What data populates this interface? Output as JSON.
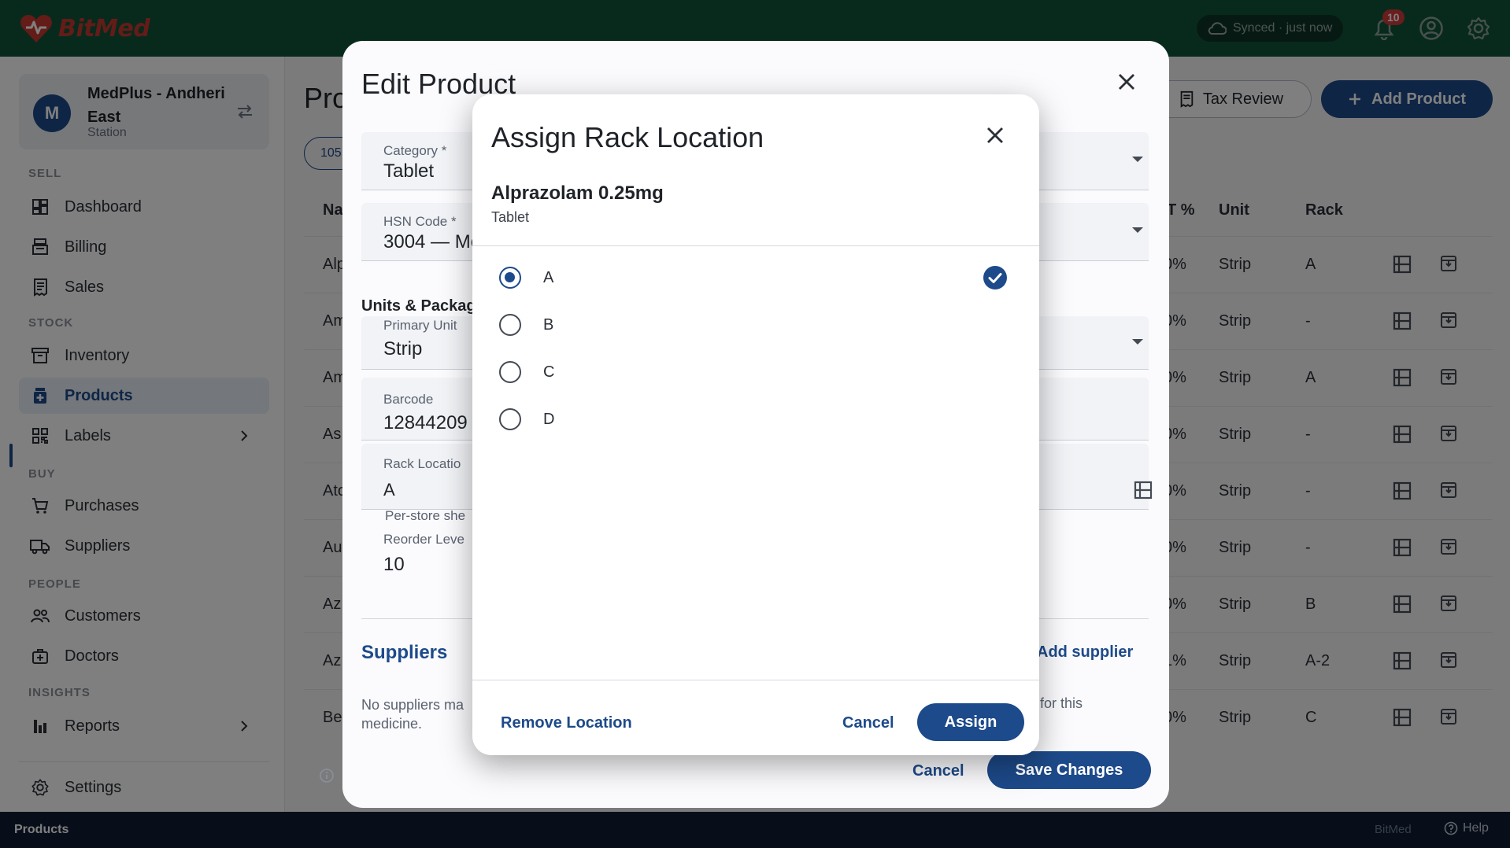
{
  "app": {
    "brand": "BitMed",
    "sync_status": "Synced · just now",
    "notification_count": "10"
  },
  "store": {
    "avatar": "M",
    "name": "MedPlus - Andheri East",
    "role": "Station"
  },
  "sidebar": {
    "sections": {
      "sell": "SELL",
      "stock": "STOCK",
      "buy": "BUY",
      "people": "PEOPLE",
      "insights": "INSIGHTS"
    },
    "items": [
      {
        "label": "Dashboard",
        "icon": "dashboard-icon"
      },
      {
        "label": "Billing",
        "icon": "billing-icon"
      },
      {
        "label": "Sales",
        "icon": "receipt-icon"
      },
      {
        "label": "Inventory",
        "icon": "inventory-icon"
      },
      {
        "label": "Products",
        "icon": "medicine-icon",
        "active": true
      },
      {
        "label": "Labels",
        "icon": "qr-code-icon"
      },
      {
        "label": "Purchases",
        "icon": "cart-icon"
      },
      {
        "label": "Suppliers",
        "icon": "truck-icon"
      },
      {
        "label": "Customers",
        "icon": "people-icon"
      },
      {
        "label": "Doctors",
        "icon": "medical-bag-icon"
      },
      {
        "label": "Reports",
        "icon": "bar-chart-icon"
      },
      {
        "label": "Settings",
        "icon": "gear-icon"
      }
    ]
  },
  "background_page": {
    "title": "Pro",
    "tax_review_label": "Tax Review",
    "add_product_label": "Add Product",
    "chip_label": "105",
    "columns": {
      "name": "Na",
      "gst": "T %",
      "unit": "Unit",
      "rack": "Rack"
    },
    "rows": [
      {
        "name": "Alp",
        "gst": "0%",
        "unit": "Strip",
        "rack": "A"
      },
      {
        "name": "Am",
        "gst": "0%",
        "unit": "Strip",
        "rack": "-"
      },
      {
        "name": "Am",
        "gst": "0%",
        "unit": "Strip",
        "rack": "A"
      },
      {
        "name": "As",
        "gst": "0%",
        "unit": "Strip",
        "rack": "-"
      },
      {
        "name": "Ato",
        "gst": "0%",
        "unit": "Strip",
        "rack": "-"
      },
      {
        "name": "Au",
        "gst": "0%",
        "unit": "Strip",
        "rack": "-"
      },
      {
        "name": "Az",
        "gst": "0%",
        "unit": "Strip",
        "rack": "B"
      },
      {
        "name": "Az",
        "gst": "1%",
        "unit": "Strip",
        "rack": "A-2"
      },
      {
        "name": "Be",
        "gst": "0%",
        "unit": "Strip",
        "rack": "C"
      }
    ]
  },
  "edit_product": {
    "title": "Edit Product",
    "category_label": "Category *",
    "category_value": "Tablet",
    "hsn_label": "HSN Code *",
    "hsn_value": "3004 — Me",
    "units_heading": "Units & Packag",
    "primary_unit_label": "Primary Unit",
    "primary_unit_value": "Strip",
    "barcode_label": "Barcode",
    "barcode_value": "12844209",
    "rack_label": "Rack Locatio",
    "rack_value": "A",
    "helper_text": "Per-store she",
    "reorder_label": "Reorder Leve",
    "reorder_value": "10",
    "suppliers_heading": "Suppliers",
    "add_supplier_label": "Add supplier",
    "no_suppliers_text": "No suppliers ma medicine.",
    "no_suppliers_tail": "for this",
    "cancel_label": "Cancel",
    "save_label": "Save Changes"
  },
  "assign_dialog": {
    "title": "Assign Rack Location",
    "product_name": "Alprazolam 0.25mg",
    "product_category": "Tablet",
    "options": [
      {
        "label": "A",
        "selected": true
      },
      {
        "label": "B",
        "selected": false
      },
      {
        "label": "C",
        "selected": false
      },
      {
        "label": "D",
        "selected": false
      }
    ],
    "remove_label": "Remove Location",
    "cancel_label": "Cancel",
    "assign_label": "Assign"
  },
  "footer": {
    "breadcrumb": "Products",
    "brand": "BitMed",
    "help_label": "Help"
  },
  "colors": {
    "primary": "#1d4a8a",
    "topbar": "#11543a",
    "brand": "#c6382e",
    "badge": "#d33a3a",
    "footer": "#0e1c34"
  }
}
